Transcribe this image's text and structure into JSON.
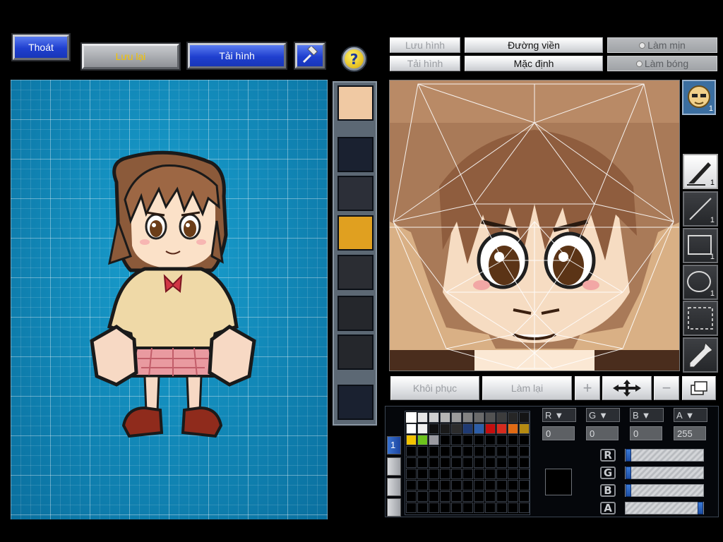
{
  "top_bar": {
    "exit_label": "Thoát",
    "save_label": "Lưu lại",
    "load_label": "Tải hình",
    "help_icon": "help-question-icon",
    "tool_icon": "hammer-icon"
  },
  "editor_bar": {
    "save_image": "Lưu hình",
    "load_image": "Tải hình",
    "outline": "Đường viền",
    "default": "Mặc định",
    "smooth": "Làm mịn",
    "gloss": "Làm bóng"
  },
  "face_indicator": {
    "count": "1"
  },
  "tools": [
    {
      "name": "pen",
      "count": "1"
    },
    {
      "name": "line",
      "count": "1"
    },
    {
      "name": "rectangle",
      "count": "1"
    },
    {
      "name": "ellipse",
      "count": "1"
    },
    {
      "name": "select",
      "count": ""
    },
    {
      "name": "eyedropper",
      "count": ""
    }
  ],
  "action_bar": {
    "restore": "Khôi phục",
    "redo": "Làm lại",
    "zoom_in": "+",
    "zoom_out": "−"
  },
  "color_panel": {
    "layer_number": "1",
    "channels": [
      {
        "label": "R",
        "value": "0"
      },
      {
        "label": "G",
        "value": "0"
      },
      {
        "label": "B",
        "value": "0"
      },
      {
        "label": "A",
        "value": "255"
      }
    ],
    "sliders": [
      {
        "label": "R",
        "fraction": 0.0
      },
      {
        "label": "G",
        "fraction": 0.0
      },
      {
        "label": "B",
        "fraction": 0.0
      },
      {
        "label": "A",
        "fraction": 1.0
      }
    ],
    "current_color": "#000000",
    "palette": [
      "#ffffff",
      "#e6e6e6",
      "#cfcfcf",
      "#b5b5b5",
      "#9b9b9b",
      "#828282",
      "#6a6a6a",
      "#525252",
      "#3c3c3c",
      "#262626",
      "#141414",
      "#ffffff",
      "#f0f0f0",
      "#0e0e0e",
      "#1a1a1a",
      "#2c2c2c",
      "#1f3a73",
      "#2d5ea8",
      "#c40e0e",
      "#d52b1e",
      "#e06a14",
      "#b58a12",
      "#f3c300",
      "#6cc21c",
      "#9a9aa0"
    ]
  },
  "colors": {
    "accent_blue": "#1f3fcf",
    "save_text": "#f4c400",
    "preview_bg": "#0b86b6"
  }
}
